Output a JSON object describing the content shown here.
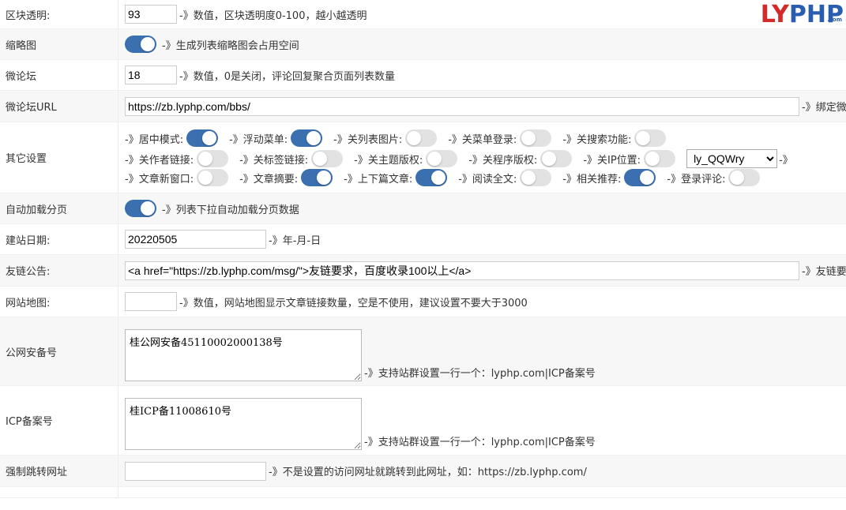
{
  "logo": {
    "ly": "LY",
    "php": "PHP",
    "com": ".com"
  },
  "rows": {
    "opacity": {
      "label": "区块透明:",
      "value": "93",
      "hint": "-》数值，区块透明度0-100，越小越透明"
    },
    "thumbnail": {
      "label": "缩略图",
      "on": true,
      "hint": "-》生成列表缩略图会占用空间"
    },
    "forum": {
      "label": "微论坛",
      "value": "18",
      "hint": "-》数值，0是关闭，评论回复聚合页面列表数量"
    },
    "forum_url": {
      "label": "微论坛URL",
      "value": "https://zb.lyphp.com/bbs/",
      "hint": "-》绑定微"
    },
    "other": {
      "label": "其它设置",
      "line1": [
        {
          "label": "-》居中模式:",
          "on": true
        },
        {
          "label": "-》浮动菜单:",
          "on": true
        },
        {
          "label": "-》关列表图片:",
          "on": false
        },
        {
          "label": "-》关菜单登录:",
          "on": false
        },
        {
          "label": "-》关搜索功能:",
          "on": false
        }
      ],
      "line2": [
        {
          "label": "-》关作者链接:",
          "on": false
        },
        {
          "label": "-》关标签链接:",
          "on": false
        },
        {
          "label": "-》关主题版权:",
          "on": false
        },
        {
          "label": "-》关程序版权:",
          "on": false
        },
        {
          "label": "-》关IP位置:",
          "on": false
        }
      ],
      "ip_db": "ly_QQWry",
      "ip_suffix": "-》",
      "line3": [
        {
          "label": "-》文章新窗口:",
          "on": false
        },
        {
          "label": "-》文章摘要:",
          "on": true
        },
        {
          "label": "-》上下篇文章:",
          "on": true
        },
        {
          "label": "-》阅读全文:",
          "on": false
        },
        {
          "label": "-》相关推荐:",
          "on": true
        },
        {
          "label": "-》登录评论:",
          "on": false
        }
      ]
    },
    "autoload": {
      "label": "自动加载分页",
      "on": true,
      "hint": "-》列表下拉自动加载分页数据"
    },
    "build_date": {
      "label": "建站日期:",
      "value": "20220505",
      "hint": "-》年-月-日"
    },
    "friend_link": {
      "label": "友链公告:",
      "value": "<a href=\"https://zb.lyphp.com/msg/\">友链要求，百度收录100以上</a>",
      "hint": "-》友链要"
    },
    "sitemap": {
      "label": "网站地图:",
      "value": "",
      "hint": "-》数值，网站地图显示文章链接数量，空是不使用，建议设置不要大于3000"
    },
    "police": {
      "label": "公网安备号",
      "value": "桂公网安备45110002000138号",
      "hint": "-》支持站群设置一行一个：lyphp.com|ICP备案号"
    },
    "icp": {
      "label": "ICP备案号",
      "value": "桂ICP备11008610号",
      "hint": "-》支持站群设置一行一个：lyphp.com|ICP备案号"
    },
    "redirect": {
      "label": "强制跳转网址",
      "value": "",
      "hint": "-》不是设置的访问网址就跳转到此网址，如：https://zb.lyphp.com/"
    }
  }
}
